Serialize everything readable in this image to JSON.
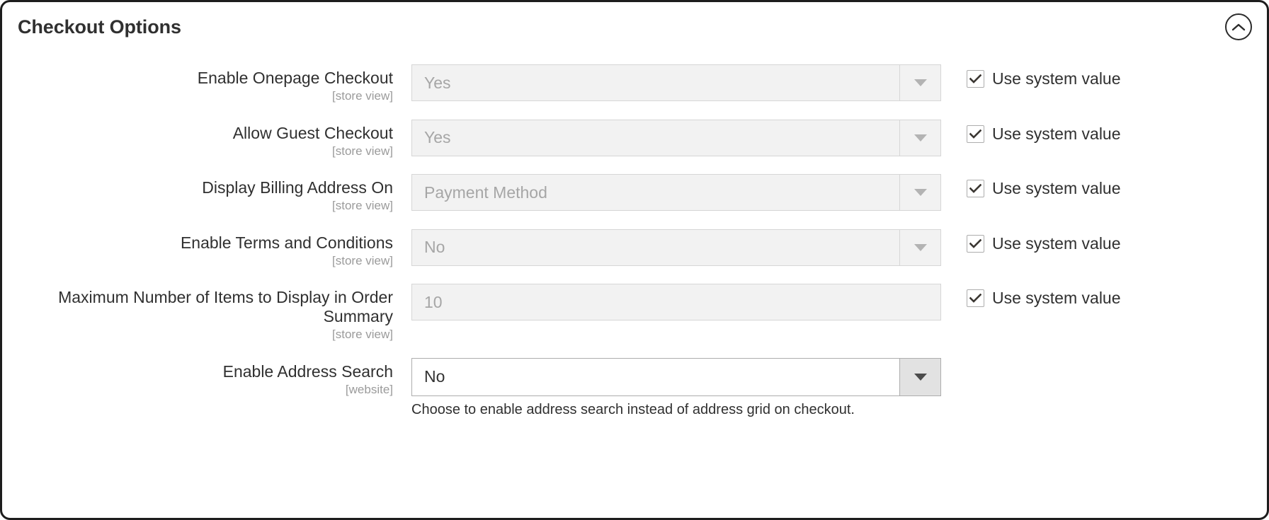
{
  "panel": {
    "title": "Checkout Options",
    "collapse_icon": "chevron-up-icon"
  },
  "common": {
    "use_system_value_label": "Use system value",
    "checkbox_icon": "checkmark-icon",
    "dropdown_icon": "caret-down-icon"
  },
  "fields": [
    {
      "label": "Enable Onepage Checkout",
      "scope": "[store view]",
      "control": "select",
      "value": "Yes",
      "disabled": true,
      "use_system_value": true,
      "use_system_value_checked": true,
      "help": ""
    },
    {
      "label": "Allow Guest Checkout",
      "scope": "[store view]",
      "control": "select",
      "value": "Yes",
      "disabled": true,
      "use_system_value": true,
      "use_system_value_checked": true,
      "help": ""
    },
    {
      "label": "Display Billing Address On",
      "scope": "[store view]",
      "control": "select",
      "value": "Payment Method",
      "disabled": true,
      "use_system_value": true,
      "use_system_value_checked": true,
      "help": ""
    },
    {
      "label": "Enable Terms and Conditions",
      "scope": "[store view]",
      "control": "select",
      "value": "No",
      "disabled": true,
      "use_system_value": true,
      "use_system_value_checked": true,
      "help": ""
    },
    {
      "label": "Maximum Number of Items to Display in Order Summary",
      "scope": "[store view]",
      "control": "text",
      "value": "10",
      "disabled": true,
      "use_system_value": true,
      "use_system_value_checked": true,
      "help": ""
    },
    {
      "label": "Enable Address Search",
      "scope": "[website]",
      "control": "select",
      "value": "No",
      "disabled": false,
      "use_system_value": false,
      "use_system_value_checked": false,
      "help": "Choose to enable address search instead of address grid on checkout."
    }
  ],
  "colors": {
    "border": "#1d1d1d",
    "title_text": "#303030",
    "label_text": "#303030",
    "scope_text": "#9b9b9b",
    "disabled_field_bg": "#f2f2f2",
    "disabled_field_text": "#a6a6a6",
    "enabled_field_bg": "#ffffff",
    "enabled_field_text": "#333333",
    "enabled_arrow_bg": "#e2e2e2"
  }
}
